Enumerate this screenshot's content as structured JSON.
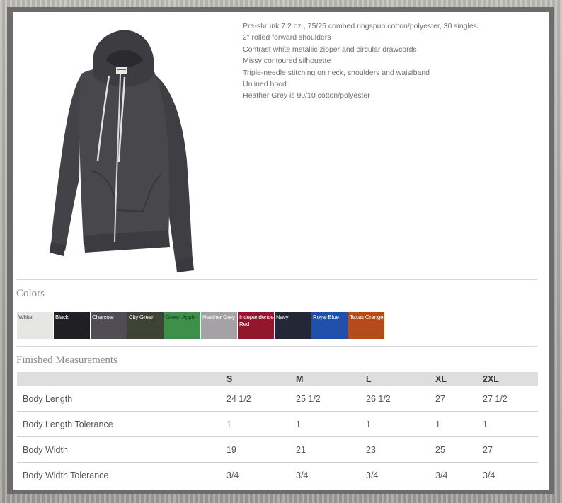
{
  "features": [
    "Pre-shrunk 7.2 oz., 75/25 combed ringspun cotton/polyester, 30 singles",
    "2\" rolled forward shoulders",
    "Contrast white metallic zipper and circular drawcords",
    "Missy contoured silhouette",
    "Triple-needle stitching on neck, shoulders and waistband",
    "Unlined hood",
    "Heather Grey is 90/10 cotton/polyester"
  ],
  "colors_title": "Colors",
  "colors": [
    {
      "name": "White",
      "hex": "#e6e6e3",
      "text": "#555555"
    },
    {
      "name": "Black",
      "hex": "#1f1f24",
      "text": "#ffffff"
    },
    {
      "name": "Charcoal",
      "hex": "#4f4c53",
      "text": "#ffffff"
    },
    {
      "name": "City Green",
      "hex": "#3e4434",
      "text": "#ffffff"
    },
    {
      "name": "Green Apple",
      "hex": "#3f8f48",
      "text": "#1a3d1f"
    },
    {
      "name": "Heather Grey",
      "hex": "#a4a2a4",
      "text": "#ffffff"
    },
    {
      "name": "Independence Red",
      "hex": "#93162c",
      "text": "#ffffff"
    },
    {
      "name": "Navy",
      "hex": "#232736",
      "text": "#ffffff"
    },
    {
      "name": "Royal Blue",
      "hex": "#1f4fa9",
      "text": "#ffffff"
    },
    {
      "name": "Texas Orange",
      "hex": "#b54a1c",
      "text": "#ffffff"
    }
  ],
  "measurements_title": "Finished Measurements",
  "table": {
    "headers": [
      "",
      "S",
      "M",
      "L",
      "XL",
      "2XL"
    ],
    "rows": [
      [
        "Body Length",
        "24 1/2",
        "25 1/2",
        "26 1/2",
        "27",
        "27 1/2"
      ],
      [
        "Body Length Tolerance",
        "1",
        "1",
        "1",
        "1",
        "1"
      ],
      [
        "Body Width",
        "19",
        "21",
        "23",
        "25",
        "27"
      ],
      [
        "Body Width Tolerance",
        "3/4",
        "3/4",
        "3/4",
        "3/4",
        "3/4"
      ]
    ]
  },
  "product_color": "#464549"
}
